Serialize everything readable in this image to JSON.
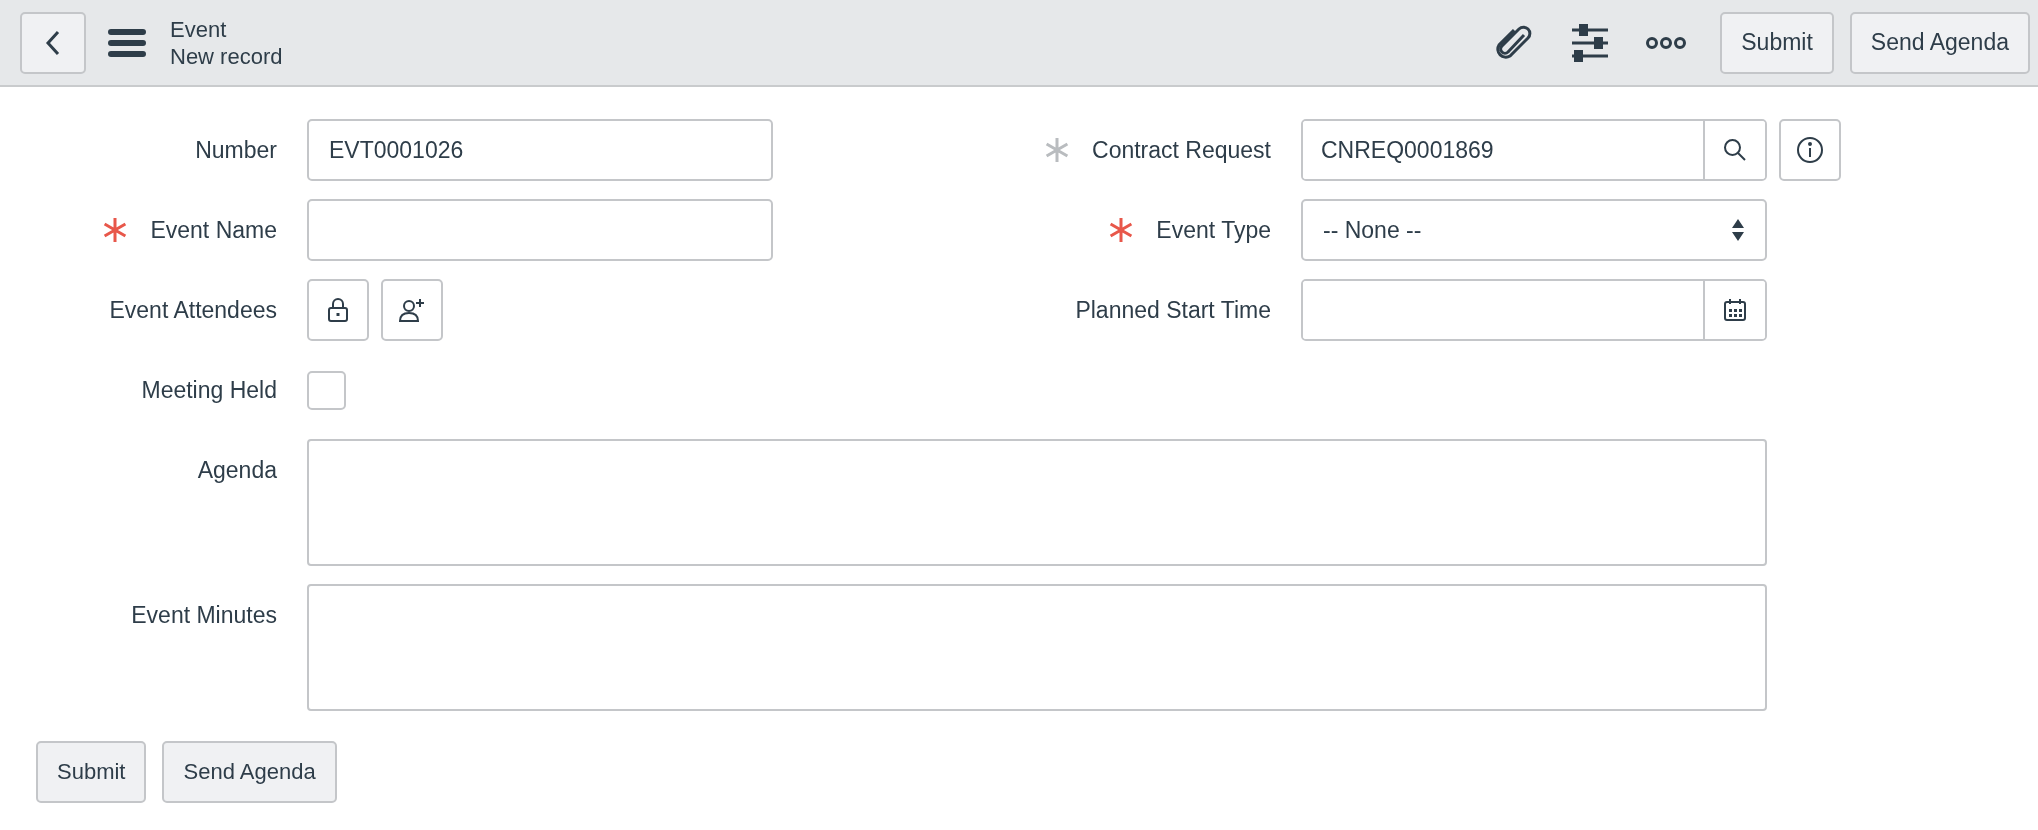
{
  "header": {
    "title": "Event",
    "subtitle": "New record",
    "buttons": [
      "Submit",
      "Send Agenda"
    ]
  },
  "left_fields": [
    {
      "kind": "text",
      "label": "Number",
      "value": "EVT0001026"
    },
    {
      "kind": "text",
      "label": "Event Name",
      "required": true,
      "satisfied": false
    },
    {
      "kind": "attendees",
      "label": "Event Attendees"
    },
    {
      "kind": "checkbox",
      "label": "Meeting Held",
      "checked": false
    }
  ],
  "right_fields": [
    {
      "kind": "reference",
      "label": "Contract Request",
      "required": true,
      "satisfied": true,
      "value": "CNREQ0001869"
    },
    {
      "kind": "select",
      "label": "Event Type",
      "required": true,
      "satisfied": false,
      "value": "-- None --"
    },
    {
      "kind": "date",
      "label": "Planned Start Time"
    }
  ],
  "wide_fields": [
    {
      "kind": "textarea",
      "label": "Agenda"
    },
    {
      "kind": "textarea",
      "label": "Event Minutes"
    }
  ],
  "footer_buttons": [
    "Submit",
    "Send Agenda"
  ]
}
